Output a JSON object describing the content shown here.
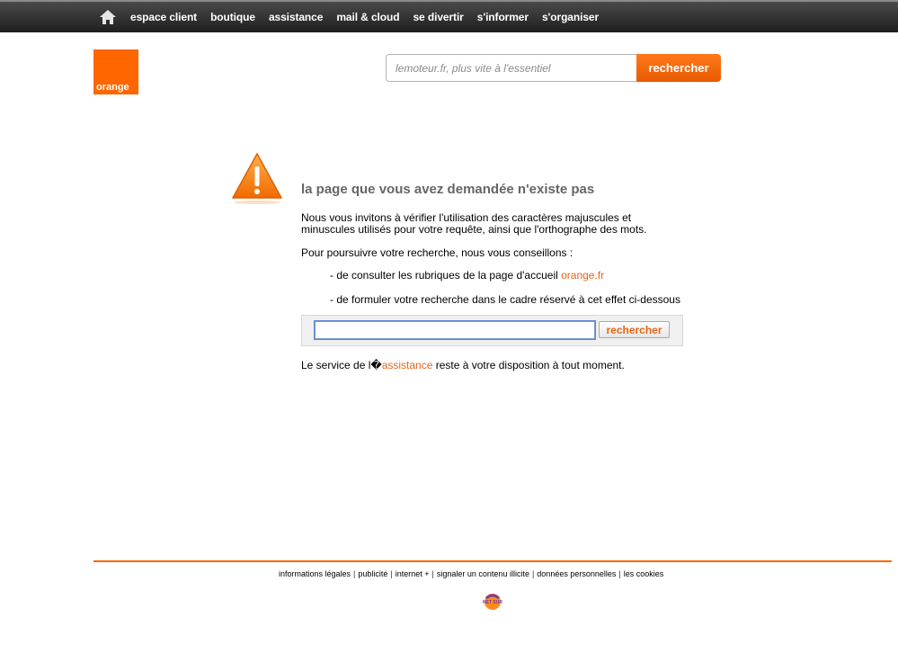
{
  "nav": {
    "items": [
      "espace client",
      "boutique",
      "assistance",
      "mail & cloud",
      "se divertir",
      "s'informer",
      "s'organiser"
    ]
  },
  "logo": {
    "text": "orange"
  },
  "top_search": {
    "placeholder": "lemoteur.fr, plus vite à l'essentiel",
    "button": "rechercher"
  },
  "error": {
    "title": "la page que vous avez demandée n'existe pas",
    "invite": "Nous vous invitons à vérifier l'utilisation des caractères majuscules et minuscules utilisés pour votre requête, ainsi que l'orthographe des mots.",
    "advice": "Pour poursuivre votre recherche, nous vous conseillons :",
    "item1_text": "- de consulter les rubriques de la page d'accueil ",
    "item1_link": "orange.fr",
    "item2_text": "- de formuler votre recherche dans le cadre réservé à cet effet ci-dessous",
    "search_button": "rechercher",
    "service_prefix": "Le service de l�",
    "service_link": "assistance",
    "service_suffix": " reste à votre disposition à tout moment."
  },
  "footer": {
    "links": [
      "informations légales",
      "publicité",
      "internet +",
      "signaler un contenu illicite",
      "données personnelles",
      "les cookies"
    ],
    "badge": "NET SUR"
  },
  "colors": {
    "accent": "#ff6600",
    "link": "#e5661b",
    "topbar": "#2a2a2a"
  }
}
